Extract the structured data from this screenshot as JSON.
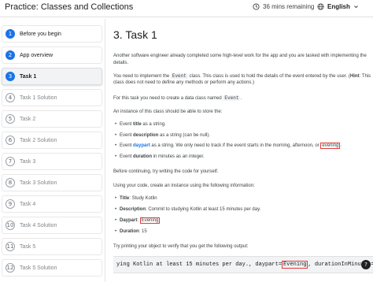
{
  "header": {
    "title": "Practice: Classes and Collections",
    "timer": "36 mins remaining",
    "language": "English",
    "timer_icon": "clock-icon",
    "language_icon": "globe-icon"
  },
  "sidebar": {
    "items": [
      {
        "number": "1",
        "label": "Before you begin",
        "state": "done"
      },
      {
        "number": "2",
        "label": "App overview",
        "state": "done"
      },
      {
        "number": "3",
        "label": "Task 1",
        "state": "active"
      },
      {
        "number": "4",
        "label": "Task 1 Solution",
        "state": "todo"
      },
      {
        "number": "5",
        "label": "Task 2",
        "state": "todo"
      },
      {
        "number": "6",
        "label": "Task 2 Solution",
        "state": "todo"
      },
      {
        "number": "7",
        "label": "Task 3",
        "state": "todo"
      },
      {
        "number": "8",
        "label": "Task 3 Solution",
        "state": "todo"
      },
      {
        "number": "9",
        "label": "Task 4",
        "state": "todo"
      },
      {
        "number": "10",
        "label": "Task 4 Solution",
        "state": "todo"
      },
      {
        "number": "11",
        "label": "Task 5",
        "state": "todo"
      },
      {
        "number": "12",
        "label": "Task 5 Solution",
        "state": "todo"
      }
    ]
  },
  "main": {
    "heading": "3. Task 1",
    "intro_1": "Another software engineer already completed some high-level work for the app and you are tasked with implementing the",
    "intro_2": "details.",
    "p2_a": "You need to implement the ",
    "p2_code": "Event",
    "p2_b": " class. This class is used to hold the details of the event entered by the user. (",
    "p2_hint": "Hint",
    "p2_c": ": This",
    "p2_line2": "class does not need to define any methods or perform any actions.)",
    "p3_a": "For this task you need to create a data class named ",
    "p3_code": "Event",
    "p3_b": ".",
    "p4": "An instance of this class should be able to store the:",
    "bullets": {
      "b1_pre": "Event ",
      "b1_bold": "title",
      "b1_post": " as a string.",
      "b2_pre": "Event ",
      "b2_bold": "description",
      "b2_post": " as a string (can be null).",
      "b3_pre": "Event ",
      "b3_bold": "daypart",
      "b3_mid": " as a string. We only need to track if the event starts in the morning, afternoon, or ",
      "b3_hl": "evening",
      "b3_post": ".",
      "b4_pre": "Event ",
      "b4_bold": "duration",
      "b4_post": " in minutes as an integer."
    },
    "p5": "Before continuing, try writing the code for yourself.",
    "p6": "Using your code, create an instance using the following information:",
    "info": {
      "i1_label": "Title",
      "i1_value": ": Study Kotlin",
      "i2_label": "Description",
      "i2_value": ": Commit to studying Kotlin at least 15 minutes per day.",
      "i3_label": "Daypart",
      "i3_sep": ": ",
      "i3_value": "Evening",
      "i4_label": "Duration",
      "i4_value": ": 15"
    },
    "p7": "Try printing your object to verify that you get the following output:",
    "code_pre": "ying Kotlin at least 15 minutes per day., daypart=",
    "code_hl": "Evening",
    "code_post": ", durationInMinutes=15)"
  },
  "fab_label": "?",
  "colors": {
    "accent": "#1a73e8",
    "highlight_box": "#e53935"
  }
}
